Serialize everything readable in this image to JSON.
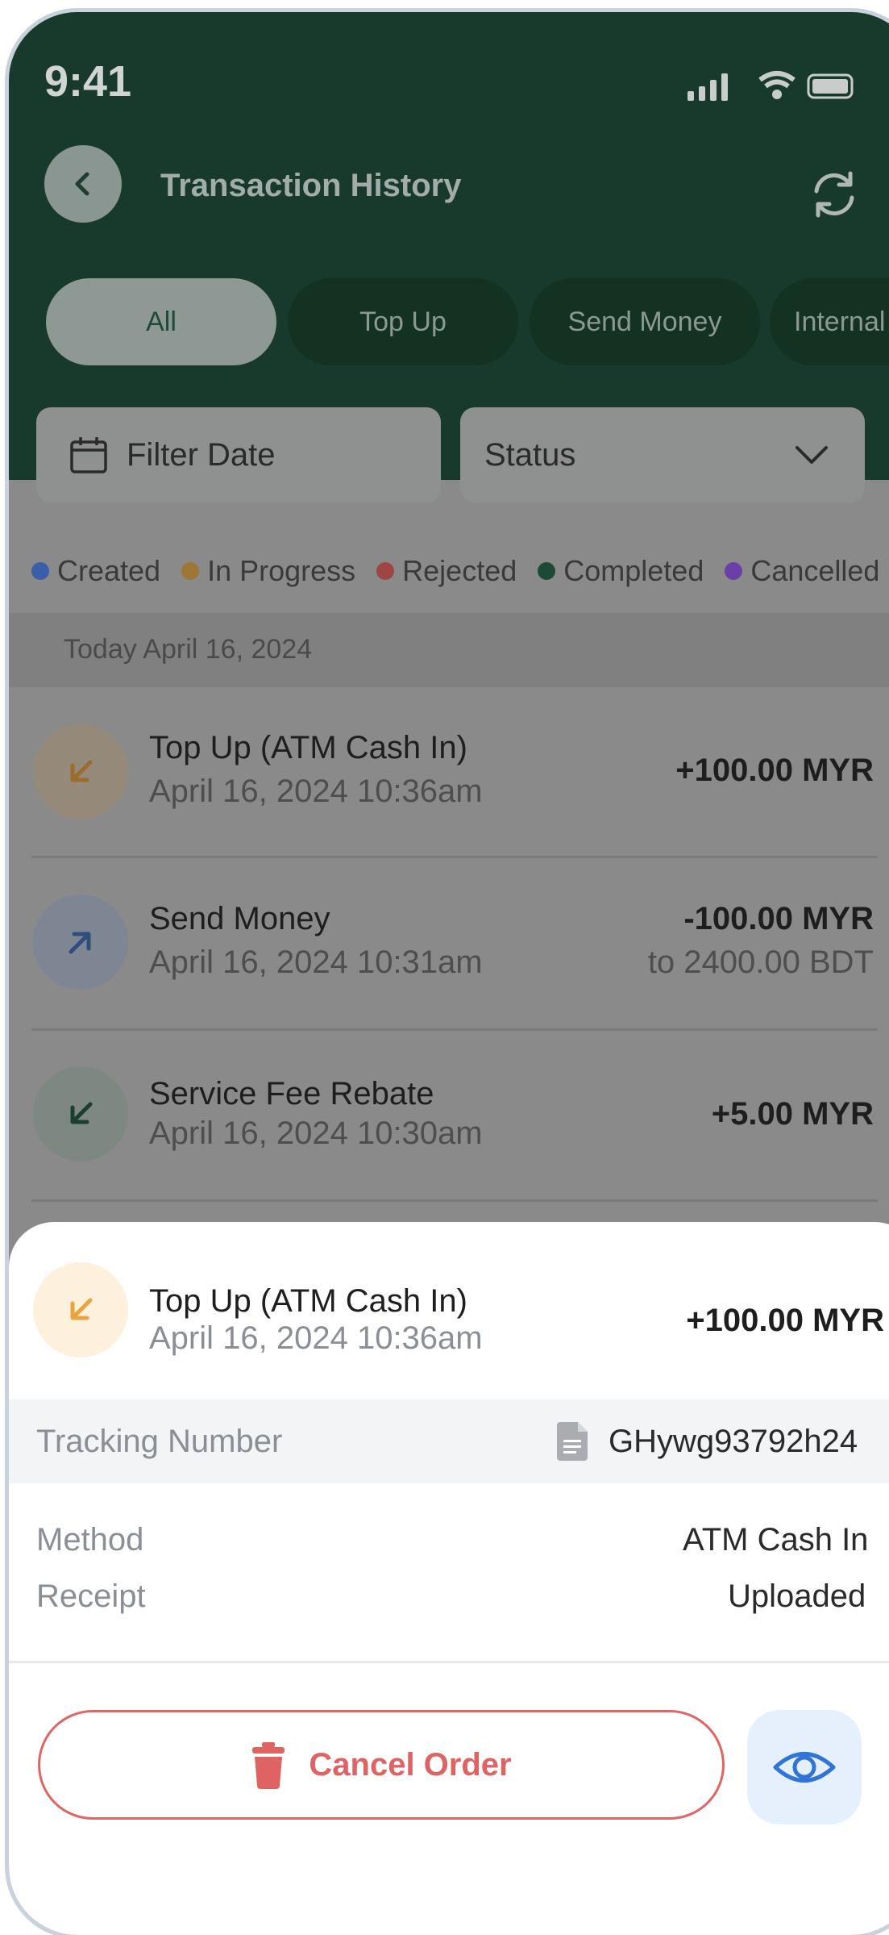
{
  "status_bar": {
    "time": "9:41"
  },
  "header": {
    "title": "Transaction History"
  },
  "tabs": [
    {
      "label": "All"
    },
    {
      "label": "Top Up"
    },
    {
      "label": "Send Money"
    },
    {
      "label": "Internal"
    }
  ],
  "filters": {
    "date_label": "Filter Date",
    "status_label": "Status"
  },
  "legend": [
    {
      "label": "Created",
      "color": "#3a62b8"
    },
    {
      "label": "In Progress",
      "color": "#b8852a"
    },
    {
      "label": "Rejected",
      "color": "#b84444"
    },
    {
      "label": "Completed",
      "color": "#1d5a3c"
    },
    {
      "label": "Cancelled",
      "color": "#6a3ab8"
    }
  ],
  "date_group": {
    "label": "Today  April 16, 2024"
  },
  "transactions": [
    {
      "title": "Top Up (ATM Cash In)",
      "datetime": "April 16, 2024  10:36am",
      "amount": "+100.00 MYR",
      "amount_sub": ""
    },
    {
      "title": "Send Money",
      "datetime": "April 16, 2024  10:31am",
      "amount": "-100.00 MYR",
      "amount_sub": "to 2400.00 BDT"
    },
    {
      "title": "Service Fee Rebate",
      "datetime": "April 16, 2024  10:30am",
      "amount": "+5.00 MYR",
      "amount_sub": ""
    }
  ],
  "detail_sheet": {
    "title": "Top Up (ATM Cash In)",
    "datetime": "April 16, 2024  10:36am",
    "amount": "+100.00 MYR",
    "tracking_label": "Tracking Number",
    "tracking_value": "GHywg93792h24",
    "method_label": "Method",
    "method_value": "ATM Cash In",
    "receipt_label": "Receipt",
    "receipt_value": "Uploaded",
    "cancel_label": "Cancel Order"
  }
}
